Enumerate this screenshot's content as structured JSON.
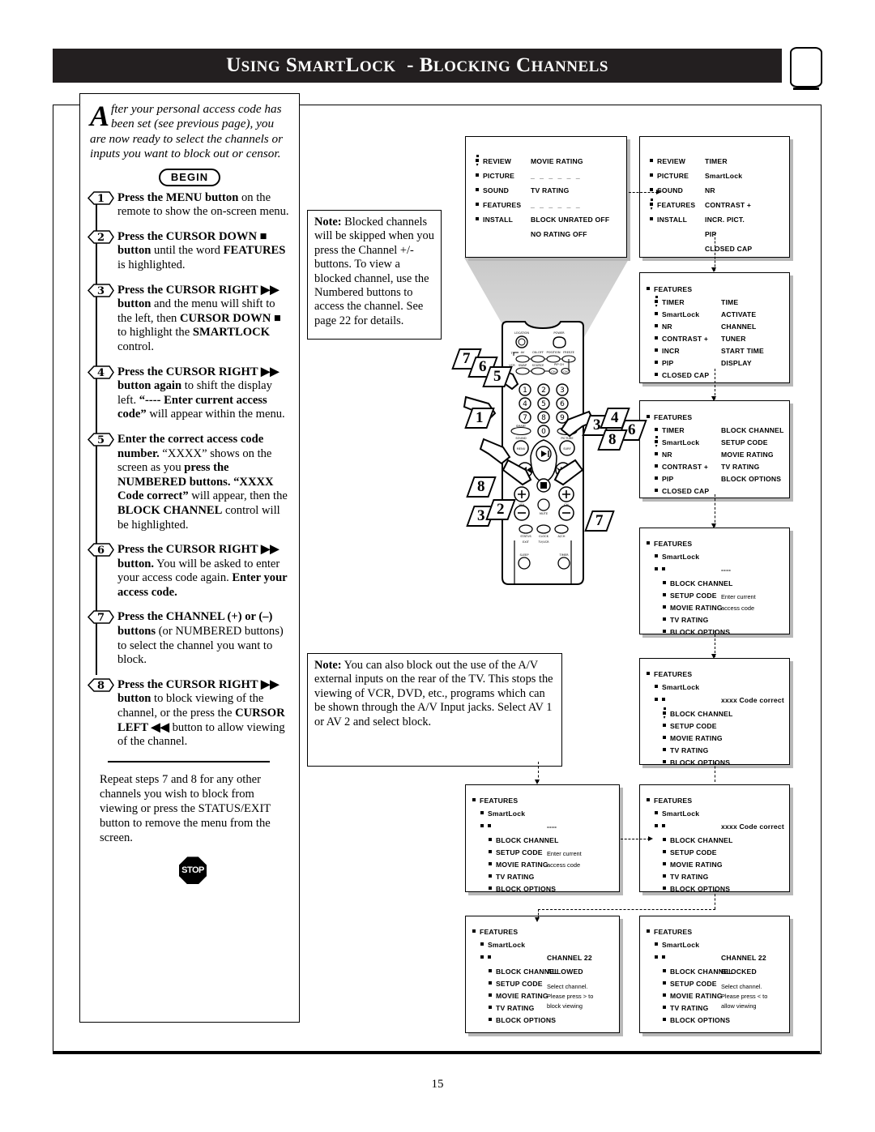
{
  "header": {
    "title_parts": [
      "U",
      "SING ",
      "S",
      "MART",
      "L",
      "OCK - ",
      "B",
      "LOCKING ",
      "C",
      "HANNELS"
    ],
    "title_full": "USING SMARTLOCK - BLOCKING CHANNELS",
    "logo_name": "tv-icon"
  },
  "intro": {
    "dropcap": "A",
    "text": "fter your personal access code has been set (see previous page), you are now ready to select the channels or inputs you want to block out or censor.",
    "begin_label": "BEGIN"
  },
  "steps": [
    {
      "n": "1",
      "html": "<b>Press the MENU button</b> on the remote to show the on-screen menu."
    },
    {
      "n": "2",
      "html": "<b>Press the CURSOR DOWN ■ button</b> until the word <b>FEATURES</b> is highlighted."
    },
    {
      "n": "3",
      "html": "<b>Press the CURSOR RIGHT ▶▶ button</b> and the menu will shift to the left, then <b>CURSOR DOWN ■</b> to highlight the <b>SMARTLOCK</b> control."
    },
    {
      "n": "4",
      "html": "<b>Press the CURSOR RIGHT ▶▶ button again</b> to shift the display left. <b>“---- Enter current access code”</b> will appear within the menu."
    },
    {
      "n": "5",
      "html": "<b>Enter the correct access code number.</b> “XXXX” shows on the screen as you <b>press the NUMBERED buttons. “XXXX Code correct”</b> will appear, then the <b>BLOCK CHANNEL</b> control will be highlighted."
    },
    {
      "n": "6",
      "html": "<b>Press the CURSOR RIGHT ▶▶ button.</b> You will be asked to enter your access code again. <b>Enter your access code.</b>"
    },
    {
      "n": "7",
      "html": "<b>Press the CHANNEL (+) or (–) buttons</b> (or NUMBERED buttons) to select the channel you want to block."
    },
    {
      "n": "8",
      "html": "<b>Press the CURSOR RIGHT ▶▶ button</b> to block viewing of the channel, or the press the <b>CURSOR LEFT ◀◀</b> button to allow viewing of the channel."
    }
  ],
  "outro": "Repeat steps 7 and 8 for any other channels you wish to block from viewing or press the STATUS/EXIT button to remove the menu from the screen.",
  "stop_label": "STOP",
  "notes": {
    "note1_bold": "Note:",
    "note1": " Blocked channels will be skipped when you press the Channel +/- buttons. To view a blocked channel, use the Numbered buttons to access the channel. See page 22 for details.",
    "note2_bold": "Note:",
    "note2": " You can also block out the use of the A/V external inputs on the rear of the TV. This stops the viewing of VCR, DVD, etc., programs which can be shown through the A/V Input jacks. Select AV 1 or AV 2 and select block."
  },
  "osd_boxes": {
    "box1": {
      "left_items": [
        "REVIEW",
        "PICTURE",
        "SOUND",
        "FEATURES",
        "INSTALL"
      ],
      "selected_index": 0,
      "right_items": [
        "MOVIE RATING",
        "------",
        "TV RATING",
        "------",
        "BLOCK UNRATED OFF",
        "NO RATING       OFF"
      ]
    },
    "box2": {
      "left_items": [
        "REVIEW",
        "PICTURE",
        "SOUND",
        "FEATURES",
        "INSTALL"
      ],
      "selected_index": 3,
      "right_items": [
        "TIMER",
        "SmartLock",
        "NR",
        "CONTRAST +",
        "INCR. PICT.",
        "PIP",
        "CLOSED CAP"
      ]
    },
    "box3": {
      "title": "FEATURES",
      "left_items": [
        "TIMER",
        "SmartLock",
        "NR",
        "CONTRAST +",
        "INCR",
        "PIP",
        "CLOSED CAP"
      ],
      "selected_index": 0,
      "right_items": [
        "TIME",
        "ACTIVATE",
        "CHANNEL",
        "TUNER",
        "START TIME",
        "DISPLAY"
      ]
    },
    "box4": {
      "title": "FEATURES",
      "left_items": [
        "TIMER",
        "SmartLock",
        "NR",
        "CONTRAST +",
        "PIP",
        "CLOSED CAP"
      ],
      "selected_index": 1,
      "right_items": [
        "BLOCK CHANNEL",
        "SETUP CODE",
        "MOVIE RATING",
        "TV RATING",
        "BLOCK OPTIONS"
      ]
    },
    "box5": {
      "title": "FEATURES",
      "sub": "SmartLock",
      "value": "----",
      "items": [
        "BLOCK CHANNEL",
        "SETUP CODE",
        "MOVIE RATING",
        "TV RATING",
        "BLOCK OPTIONS"
      ],
      "side_text_1": "Enter current",
      "side_text_2": "access code"
    },
    "box6": {
      "title": "FEATURES",
      "sub": "SmartLock",
      "value": "xxxx Code correct",
      "items": [
        "BLOCK CHANNEL",
        "SETUP CODE",
        "MOVIE RATING",
        "TV RATING",
        "BLOCK OPTIONS"
      ],
      "selected_index": 0
    },
    "box7": {
      "title": "FEATURES",
      "sub": "SmartLock",
      "value": "----",
      "items": [
        "BLOCK CHANNEL",
        "SETUP CODE",
        "MOVIE RATING",
        "TV RATING",
        "BLOCK OPTIONS"
      ],
      "side_text_1": "Enter current",
      "side_text_2": "access code"
    },
    "box8": {
      "title": "FEATURES",
      "sub": "SmartLock",
      "value": "xxxx Code correct",
      "items": [
        "BLOCK CHANNEL",
        "SETUP CODE",
        "MOVIE RATING",
        "TV RATING",
        "BLOCK OPTIONS"
      ]
    },
    "box9": {
      "title": "FEATURES",
      "sub": "SmartLock",
      "channel": "CHANNEL 22",
      "state": "ALLOWED",
      "hint": "Select channel. Please press > to block viewing",
      "items": [
        "BLOCK CHANNEL",
        "SETUP CODE",
        "MOVIE RATING",
        "TV RATING",
        "BLOCK OPTIONS"
      ]
    },
    "box10": {
      "title": "FEATURES",
      "sub": "SmartLock",
      "channel": "CHANNEL 22",
      "state": "BLOCKED",
      "hint": "Select channel. Please press < to allow viewing",
      "items": [
        "BLOCK CHANNEL",
        "SETUP CODE",
        "MOVIE RATING",
        "TV RATING",
        "BLOCK OPTIONS"
      ]
    }
  },
  "remote": {
    "name": "remote-control-illustration",
    "callouts": [
      "1",
      "2",
      "3",
      "4",
      "5",
      "6",
      "7",
      "8"
    ],
    "button_labels": [
      "LOCATION",
      "POWER",
      "TV",
      "AV",
      "ON-OFF",
      "POSITION",
      "FREEZE",
      "VCR",
      "SWAP",
      "SOURCE",
      "PIP CH",
      "CH",
      "SMART SOUND",
      "SMART PICTURE",
      "MENU",
      "SURF",
      "VOL",
      "CH",
      "MUTE",
      "STATUS EXIT",
      "CLOCK TV/VCR",
      "A/CH",
      "SLEEP",
      "TIMER"
    ]
  },
  "page_number": "15",
  "colors": {
    "ink": "#000000",
    "header_bg": "#231f20",
    "beam": "#cdcdcd",
    "shadow": "#b8b8b8"
  }
}
